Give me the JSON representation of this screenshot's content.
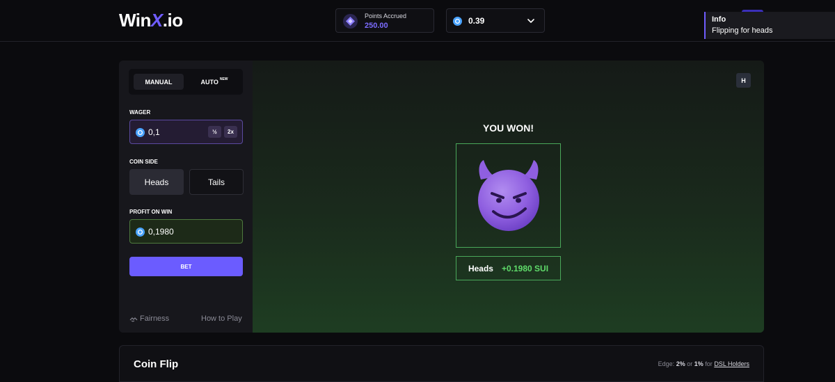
{
  "header": {
    "logo": {
      "part1": "Win",
      "part2": "X",
      "part3": ".io"
    },
    "points": {
      "label": "Points Accrued",
      "value": "250.00"
    },
    "balance": {
      "value": "0.39"
    }
  },
  "toast": {
    "title": "Info",
    "message": "Flipping for heads"
  },
  "panel": {
    "modes": {
      "manual": "MANUAL",
      "auto": "AUTO",
      "auto_badge": "NEW"
    },
    "wager": {
      "label": "WAGER",
      "value": "0,1",
      "half": "½",
      "double": "2x"
    },
    "coin_side": {
      "label": "COIN SIDE",
      "heads": "Heads",
      "tails": "Tails"
    },
    "profit": {
      "label": "PROFIT ON WIN",
      "value": "0,1980"
    },
    "bet": "BET",
    "fairness": "Fairness",
    "how_to_play": "How to Play"
  },
  "stage": {
    "badge": "H",
    "title": "YOU WON!",
    "coin": "smiling-devil-emoji",
    "result_side": "Heads",
    "result_profit": "+0.1980 SUI"
  },
  "footer": {
    "title": "Coin Flip",
    "edge_prefix": "Edge:",
    "edge_value": "2%",
    "edge_or": "or",
    "edge_value2": "1%",
    "edge_for": "for",
    "edge_link": "DSL Holders"
  },
  "colors": {
    "accent": "#6b5cff",
    "win_green": "#5fdc6a",
    "sui_blue": "#4aa3ff"
  }
}
